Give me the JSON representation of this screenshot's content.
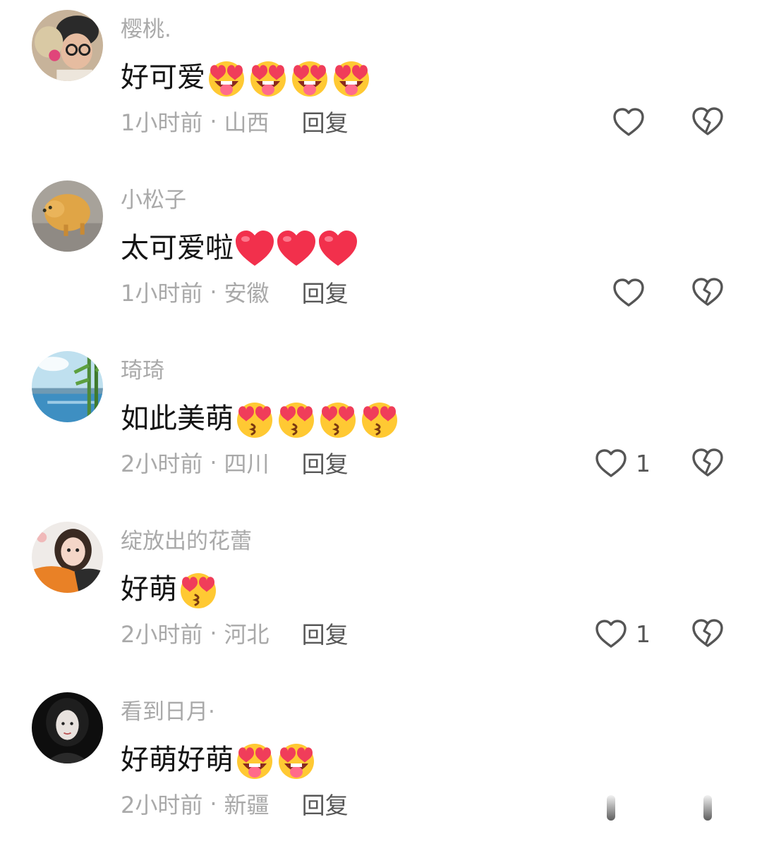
{
  "comments": [
    {
      "username": "樱桃.",
      "text": "好可爱",
      "emoji": [
        "face-with-tongue-heart-eyes",
        "face-with-tongue-heart-eyes",
        "face-with-tongue-heart-eyes",
        "face-with-tongue-heart-eyes"
      ],
      "time": "1小时前",
      "dot": "·",
      "location": "山西",
      "reply": "回复",
      "likes": ""
    },
    {
      "username": "小松子",
      "text": "太可爱啦",
      "emoji": [
        "red-heart",
        "red-heart",
        "red-heart"
      ],
      "time": "1小时前",
      "dot": "·",
      "location": "安徽",
      "reply": "回复",
      "likes": ""
    },
    {
      "username": "琦琦",
      "text": "如此美萌",
      "emoji": [
        "kissing-heart-eyes",
        "kissing-heart-eyes",
        "kissing-heart-eyes",
        "kissing-heart-eyes"
      ],
      "time": "2小时前",
      "dot": "·",
      "location": "四川",
      "reply": "回复",
      "likes": "1"
    },
    {
      "username": "绽放出的花蕾",
      "text": "好萌",
      "emoji": [
        "kissing-heart-eyes"
      ],
      "time": "2小时前",
      "dot": "·",
      "location": "河北",
      "reply": "回复",
      "likes": "1"
    },
    {
      "username": "看到日月·",
      "text": "好萌好萌",
      "emoji": [
        "face-with-tongue-heart-eyes",
        "face-with-tongue-heart-eyes"
      ],
      "time": "2小时前",
      "dot": "·",
      "location": "新疆",
      "reply": "回复",
      "likes": ""
    }
  ],
  "icons": {
    "like": "heart-outline-icon",
    "dislike": "broken-heart-icon"
  },
  "colors": {
    "username": "#a9a9a9",
    "text": "#141414",
    "meta": "#a9a9a9",
    "reply": "#575757",
    "icon": "#555555"
  }
}
